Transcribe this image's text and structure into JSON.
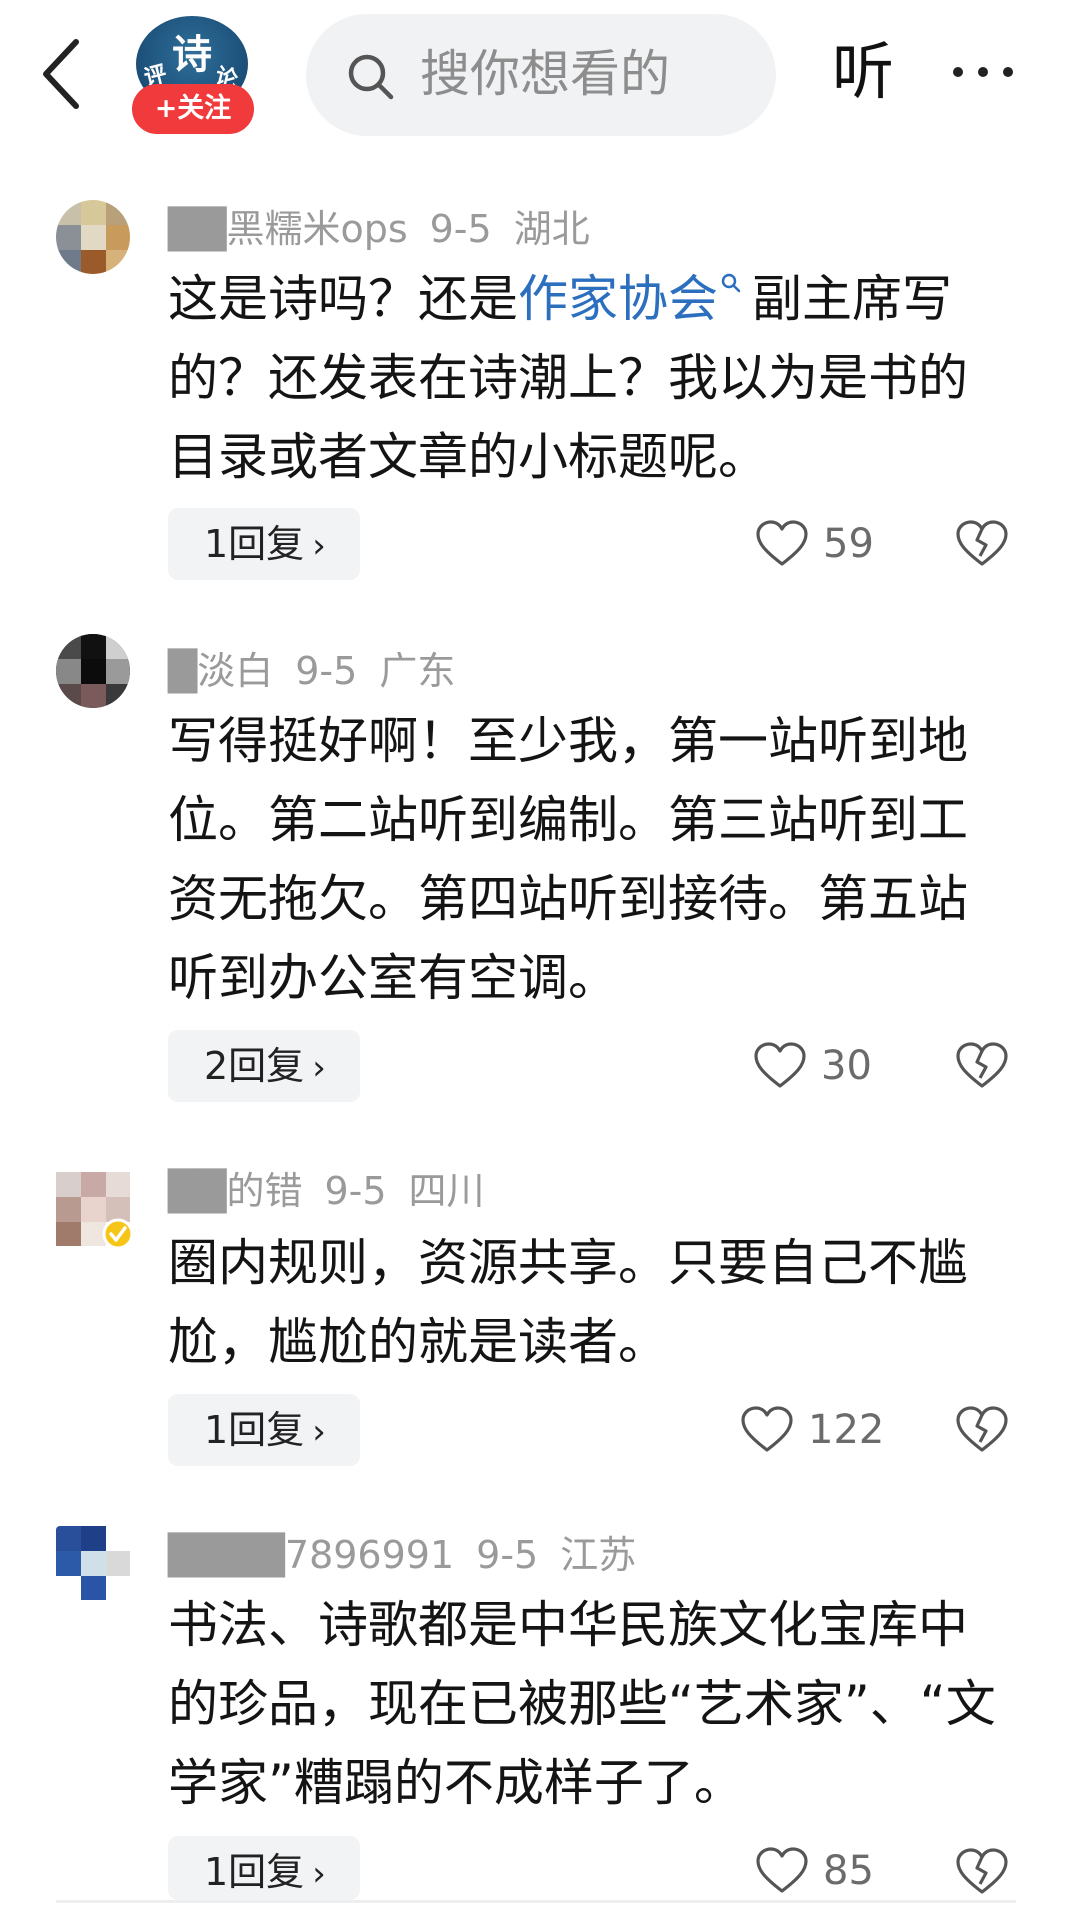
{
  "header": {
    "logo_main": "诗",
    "logo_sub_left": "评",
    "logo_sub_right": "论",
    "follow_label": "+关注",
    "search_placeholder": "搜你想看的",
    "listen_label": "听",
    "more_label": "···"
  },
  "comments": [
    {
      "username": "██黑糯米ops",
      "date": "9-5",
      "location": "湖北",
      "text_before": "这是诗吗？还是",
      "text_link": "作家协会",
      "text_after": "副主席写的？还发表在诗潮上？我以为是书的目录或者文章的小标题呢。",
      "replies_label": "1回复",
      "likes": "59"
    },
    {
      "username": "█淡白",
      "date": "9-5",
      "location": "广东",
      "text": "写得挺好啊！至少我，第一站听到地位。第二站听到编制。第三站听到工资无拖欠。第四站听到接待。第五站听到办公室有空调。",
      "replies_label": "2回复",
      "likes": "30"
    },
    {
      "username": "██的错",
      "date": "9-5",
      "location": "四川",
      "text": "圈内规则，资源共享。只要自己不尴尬，尴尬的就是读者。",
      "replies_label": "1回复",
      "likes": "122"
    },
    {
      "username": "████7896991",
      "date": "9-5",
      "location": "江苏",
      "text": "书法、诗歌都是中华民族文化宝库中的珍品，现在已被那些“艺术家”、“文学家”糟蹋的不成样子了。",
      "replies_label": "1回复",
      "likes": "85"
    }
  ],
  "colors": {
    "link": "#2c6fbf",
    "follow": "#f03a3c",
    "meta": "#9a9a9a"
  },
  "icons": [
    "back-arrow-icon",
    "search-icon",
    "more-icon",
    "heart-icon",
    "broken-heart-icon",
    "chevron-right-icon"
  ]
}
